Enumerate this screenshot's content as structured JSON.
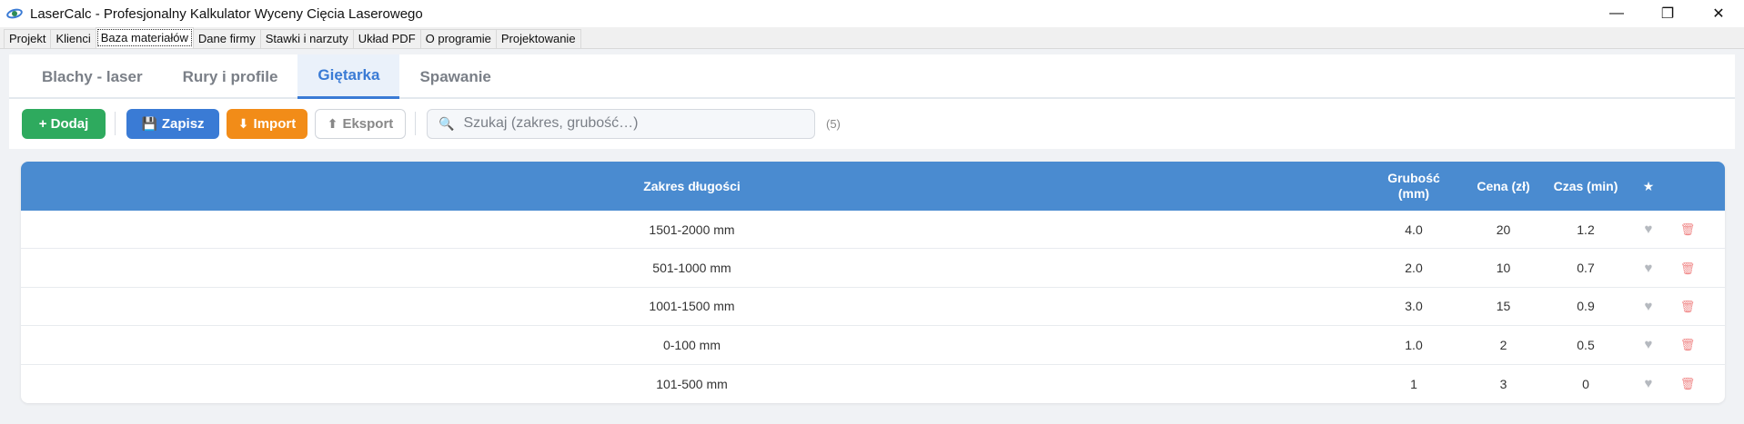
{
  "window": {
    "title": "LaserCalc - Profesjonalny Kalkulator Wyceny Cięcia Laserowego",
    "minimize": "—",
    "maximize": "❐",
    "close": "✕"
  },
  "top_tabs": [
    {
      "label": "Projekt"
    },
    {
      "label": "Klienci"
    },
    {
      "label": "Baza materiałów",
      "active": true
    },
    {
      "label": "Dane firmy"
    },
    {
      "label": "Stawki i narzuty"
    },
    {
      "label": "Układ PDF"
    },
    {
      "label": "O programie"
    },
    {
      "label": "Projektowanie"
    }
  ],
  "sub_tabs": [
    {
      "label": "Blachy - laser"
    },
    {
      "label": "Rury i profile"
    },
    {
      "label": "Giętarka",
      "active": true
    },
    {
      "label": "Spawanie"
    }
  ],
  "toolbar": {
    "add_label": "+ Dodaj",
    "save_icon": "💾",
    "save_label": "Zapisz",
    "import_icon": "⬇",
    "import_label": "Import",
    "export_icon": "⬆",
    "export_label": "Eksport",
    "search_icon": "🔍",
    "search_placeholder": "Szukaj (zakres, grubość…)",
    "count": "(5)"
  },
  "table": {
    "headers": {
      "range": "Zakres długości",
      "thickness_1": "Grubość",
      "thickness_2": "(mm)",
      "price": "Cena (zł)",
      "time": "Czas (min)",
      "fav": "★"
    },
    "rows": [
      {
        "range": "1501-2000 mm",
        "thickness": "4.0",
        "price": "20",
        "time": "1.2"
      },
      {
        "range": "501-1000 mm",
        "thickness": "2.0",
        "price": "10",
        "time": "0.7"
      },
      {
        "range": "1001-1500 mm",
        "thickness": "3.0",
        "price": "15",
        "time": "0.9"
      },
      {
        "range": "0-100 mm",
        "thickness": "1.0",
        "price": "2",
        "time": "0.5"
      },
      {
        "range": "101-500 mm",
        "thickness": "1",
        "price": "3",
        "time": "0"
      }
    ],
    "heart_glyph": "♥",
    "trash_glyph": "🗑"
  },
  "colors": {
    "accent": "#3a7bd5",
    "header_bg": "#4a8bd0",
    "add": "#2eaa5e",
    "import": "#f28c18"
  }
}
